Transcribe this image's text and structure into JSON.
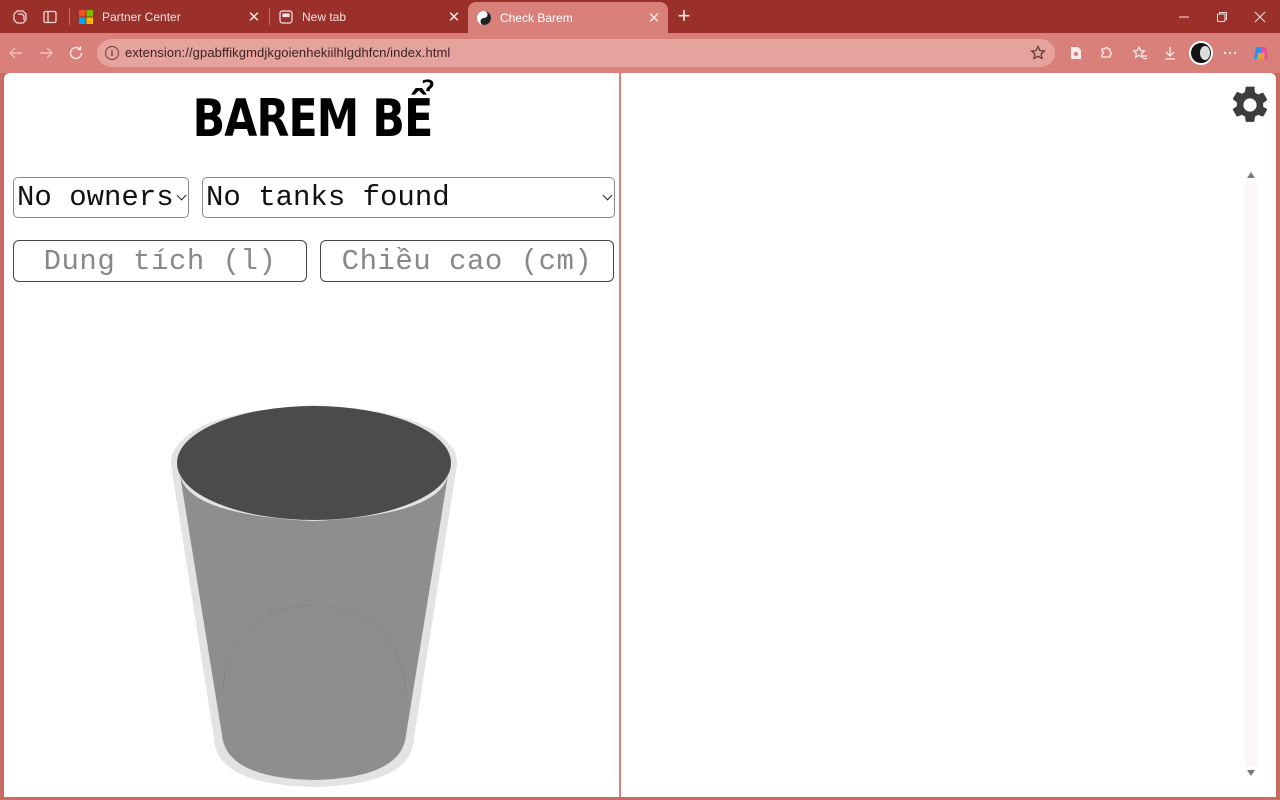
{
  "browser": {
    "tabs": [
      {
        "title": "Partner Center",
        "favicon": "microsoft-logo-icon"
      },
      {
        "title": "New tab",
        "favicon": "new-tab-icon"
      },
      {
        "title": "Check Barem",
        "favicon": "yin-yang-icon",
        "active": true
      }
    ],
    "url": "extension://gpabffikgmdjkgoienhekiilhlgdhfcn/index.html",
    "colors": {
      "frame": "#9b2f2a",
      "toolbar": "#d9807a",
      "omnibox": "#e6a29d"
    }
  },
  "app": {
    "title": "BAREM BỂ",
    "owner_select": {
      "value": "No owners"
    },
    "tank_select": {
      "value": "No tanks found"
    },
    "volume_input": {
      "placeholder": "Dung tích (l)"
    },
    "height_input": {
      "placeholder": "Chiều cao (cm)"
    },
    "tank_colors": {
      "top": "#4b4b4b",
      "body": "#8e8e8e",
      "rim": "#e3e3e3"
    },
    "settings_icon": "gear-icon"
  }
}
